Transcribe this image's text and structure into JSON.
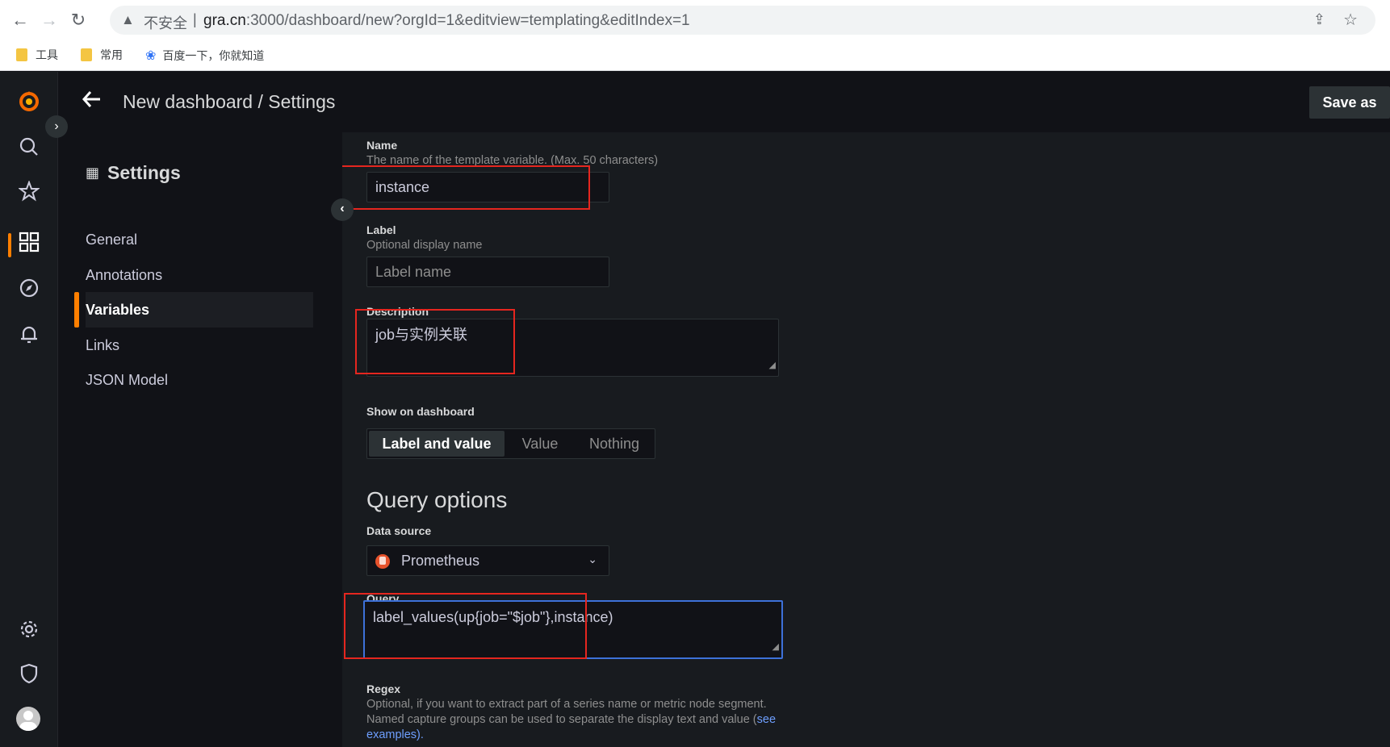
{
  "browser": {
    "warning_icon": "warning-icon",
    "insecure_label": "不安全",
    "url_host": "gra.cn",
    "url_rest": ":3000/dashboard/new?orgId=1&editview=templating&editIndex=1",
    "bookmarks": [
      "工具",
      "常用",
      "百度一下，你就知道"
    ]
  },
  "topbar": {
    "title": "New dashboard / Settings",
    "save_as": "Save as"
  },
  "settings": {
    "heading": "Settings",
    "nav": [
      {
        "label": "General"
      },
      {
        "label": "Annotations"
      },
      {
        "label": "Variables",
        "active": true
      },
      {
        "label": "Links"
      },
      {
        "label": "JSON Model"
      }
    ]
  },
  "form": {
    "name": {
      "label": "Name",
      "description": "The name of the template variable. (Max. 50 characters)",
      "value": "instance"
    },
    "label": {
      "label": "Label",
      "description": "Optional display name",
      "placeholder": "Label name"
    },
    "description": {
      "label": "Description",
      "value": "job与实例关联"
    },
    "show_on_dashboard": {
      "label": "Show on dashboard",
      "options": [
        "Label and value",
        "Value",
        "Nothing"
      ],
      "selected": "Label and value"
    },
    "query_options": {
      "title": "Query options",
      "data_source_label": "Data source",
      "data_source_value": "Prometheus",
      "query_label": "Query",
      "query_value": "label_values(up{job=\"$job\"},instance)",
      "regex_label": "Regex",
      "regex_desc_1": "Optional, if you want to extract part of a series name or metric node segment.",
      "regex_desc_2": "Named capture groups can be used to separate the display text and value (",
      "regex_link": "see",
      "regex_desc_3": "examples)."
    }
  },
  "colors": {
    "accent": "#ff7f00",
    "annotation_red": "#e5261f",
    "focus_blue": "#3d71d9"
  }
}
